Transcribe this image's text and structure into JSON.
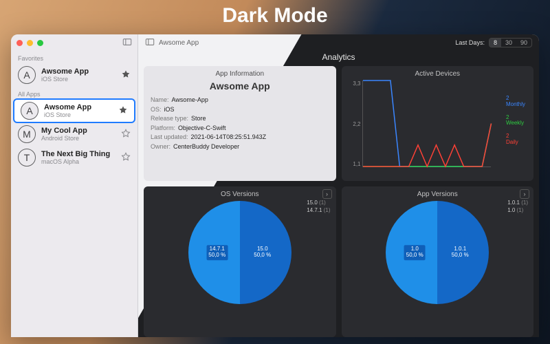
{
  "hero": "Dark Mode",
  "traffic_lights": {
    "close": "#ff5f57",
    "min": "#febc2e",
    "max": "#28c840"
  },
  "sidebar": {
    "sections": [
      {
        "label": "Favorites",
        "items": [
          {
            "initial": "A",
            "name": "Awsome App",
            "sub": "iOS  Store",
            "fav": true
          }
        ]
      },
      {
        "label": "All Apps",
        "items": [
          {
            "initial": "A",
            "name": "Awsome App",
            "sub": "iOS  Store",
            "fav": true,
            "selected": true
          },
          {
            "initial": "M",
            "name": "My Cool App",
            "sub": "Android  Store",
            "fav": false
          },
          {
            "initial": "T",
            "name": "The Next Big Thing",
            "sub": "macOS  Alpha",
            "fav": false
          }
        ]
      }
    ]
  },
  "toolbar": {
    "title": "Awsome App",
    "lastdays_label": "Last Days:",
    "segments": [
      "8",
      "30",
      "90"
    ],
    "active_segment": 0
  },
  "analytics_title": "Analytics",
  "info_card": {
    "title": "App Information",
    "appname": "Awsome App",
    "rows": [
      {
        "k": "Name:",
        "v": "Awsome-App"
      },
      {
        "k": "OS:",
        "v": "iOS"
      },
      {
        "k": "Release type:",
        "v": "Store"
      },
      {
        "k": "Platform:",
        "v": "Objective-C-Swift"
      },
      {
        "k": "Last updated:",
        "v": "2021-06-14T08:25:51.943Z"
      },
      {
        "k": "Owner:",
        "v": "CenterBuddy Developer"
      }
    ]
  },
  "chart_data": {
    "type": "line",
    "title": "Active Devices",
    "ylabel": "",
    "xlabel": "",
    "ylim": [
      0,
      4
    ],
    "yticks": [
      "3,3",
      "2,2",
      "1,1"
    ],
    "x": [
      0,
      1,
      2,
      3,
      4,
      5,
      6,
      7,
      8,
      9,
      10,
      11,
      12,
      13,
      14
    ],
    "series": [
      {
        "name": "Monthly",
        "color": "#3a86ff",
        "legend_value": "2",
        "values": [
          4,
          4,
          4,
          4,
          0,
          0,
          0,
          0,
          0,
          0,
          0,
          0,
          0,
          0,
          2
        ]
      },
      {
        "name": "Weekly",
        "color": "#2ecc40",
        "legend_value": "2",
        "values": [
          0,
          0,
          0,
          0,
          0,
          0,
          0,
          0,
          0,
          0,
          0,
          0,
          0,
          0,
          2
        ]
      },
      {
        "name": "Daily",
        "color": "#ff4136",
        "legend_value": "2",
        "values": [
          0,
          0,
          0,
          0,
          0,
          0,
          1,
          0,
          1,
          0,
          1,
          0,
          0,
          0,
          2
        ]
      }
    ]
  },
  "os_versions": {
    "title": "OS Versions",
    "legend": [
      {
        "label": "15.0",
        "count": "(1)"
      },
      {
        "label": "14.7.1",
        "count": "(1)"
      }
    ],
    "slices": [
      {
        "label": "14.7.1",
        "pct": "50,0 %",
        "color": "#1f8fe8"
      },
      {
        "label": "15.0",
        "pct": "50,0 %",
        "color": "#1468c7"
      }
    ]
  },
  "app_versions": {
    "title": "App Versions",
    "legend": [
      {
        "label": "1.0.1",
        "count": "(1)"
      },
      {
        "label": "1.0",
        "count": "(1)"
      }
    ],
    "slices": [
      {
        "label": "1.0",
        "pct": "50,0 %",
        "color": "#1f8fe8"
      },
      {
        "label": "1.0.1",
        "pct": "50,0 %",
        "color": "#1468c7"
      }
    ]
  }
}
